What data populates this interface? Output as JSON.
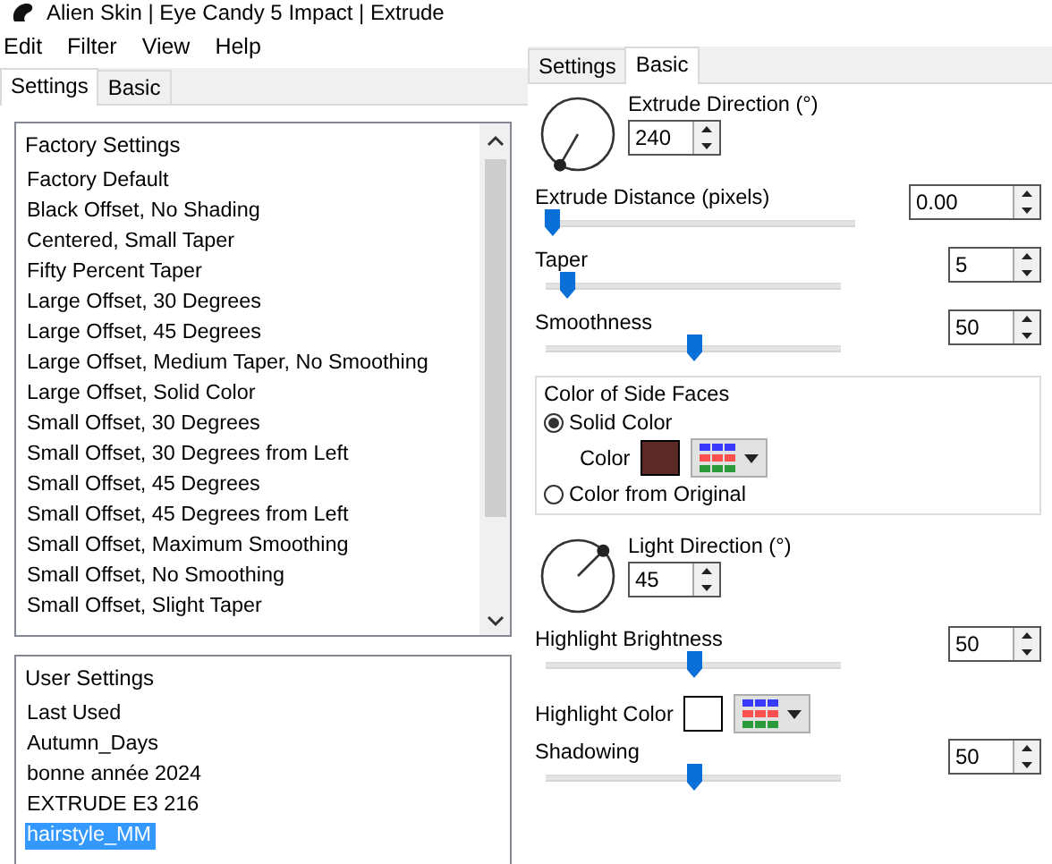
{
  "window": {
    "title": "Alien Skin | Eye Candy 5 Impact | Extrude"
  },
  "menu": [
    "Edit",
    "Filter",
    "View",
    "Help"
  ],
  "left_tabs": [
    {
      "label": "Settings",
      "selected": true
    },
    {
      "label": "Basic",
      "selected": false
    }
  ],
  "factory_settings": {
    "header": "Factory Settings",
    "items": [
      {
        "label": "Factory Default",
        "selected": false
      },
      {
        "label": "Black Offset, No Shading",
        "selected": false
      },
      {
        "label": "Centered, Small Taper",
        "selected": false
      },
      {
        "label": "Fifty Percent Taper",
        "selected": false
      },
      {
        "label": "Large Offset, 30 Degrees",
        "selected": false
      },
      {
        "label": "Large Offset, 45 Degrees",
        "selected": false
      },
      {
        "label": "Large Offset, Medium Taper, No Smoothing",
        "selected": false
      },
      {
        "label": "Large Offset, Solid Color",
        "selected": false
      },
      {
        "label": "Small Offset, 30 Degrees",
        "selected": false
      },
      {
        "label": "Small Offset, 30 Degrees from Left",
        "selected": false
      },
      {
        "label": "Small Offset, 45 Degrees",
        "selected": false
      },
      {
        "label": "Small Offset, 45 Degrees from Left",
        "selected": false
      },
      {
        "label": "Small Offset, Maximum Smoothing",
        "selected": false
      },
      {
        "label": "Small Offset, No Smoothing",
        "selected": false
      },
      {
        "label": "Small Offset, Slight Taper",
        "selected": false
      }
    ]
  },
  "user_settings": {
    "header": "User Settings",
    "items": [
      {
        "label": "Last Used",
        "selected": false
      },
      {
        "label": "Autumn_Days",
        "selected": false
      },
      {
        "label": "bonne année 2024",
        "selected": false
      },
      {
        "label": "EXTRUDE E3 216",
        "selected": false
      },
      {
        "label": "hairstyle_MM",
        "selected": true
      }
    ]
  },
  "right_tabs": [
    {
      "label": "Settings",
      "selected": false
    },
    {
      "label": "Basic",
      "selected": true
    }
  ],
  "controls": [
    {
      "kind": "dial",
      "label": "Extrude Direction (°)",
      "value": "240"
    },
    {
      "kind": "slider",
      "label": "Extrude Distance (pixels)",
      "value": "0.00",
      "level": 0.02
    },
    {
      "kind": "slider",
      "label": "Taper",
      "value": "5",
      "level": 0.07
    },
    {
      "kind": "slider",
      "label": "Smoothness",
      "value": "50",
      "level": 0.5
    },
    {
      "kind": "group",
      "title": "Color of Side Faces",
      "options": [
        {
          "label": "Solid Color",
          "selected": true
        },
        {
          "label": "Color from Original",
          "selected": false
        }
      ],
      "color_label": "Color",
      "color": "#5c2a26"
    },
    {
      "kind": "dial",
      "label": "Light Direction (°)",
      "value": "45"
    },
    {
      "kind": "slider",
      "label": "Highlight Brightness",
      "value": "50",
      "level": 0.5
    },
    {
      "kind": "color",
      "label": "Highlight Color",
      "color": "#ffffff"
    },
    {
      "kind": "slider",
      "label": "Shadowing",
      "value": "50",
      "level": 0.5
    }
  ]
}
